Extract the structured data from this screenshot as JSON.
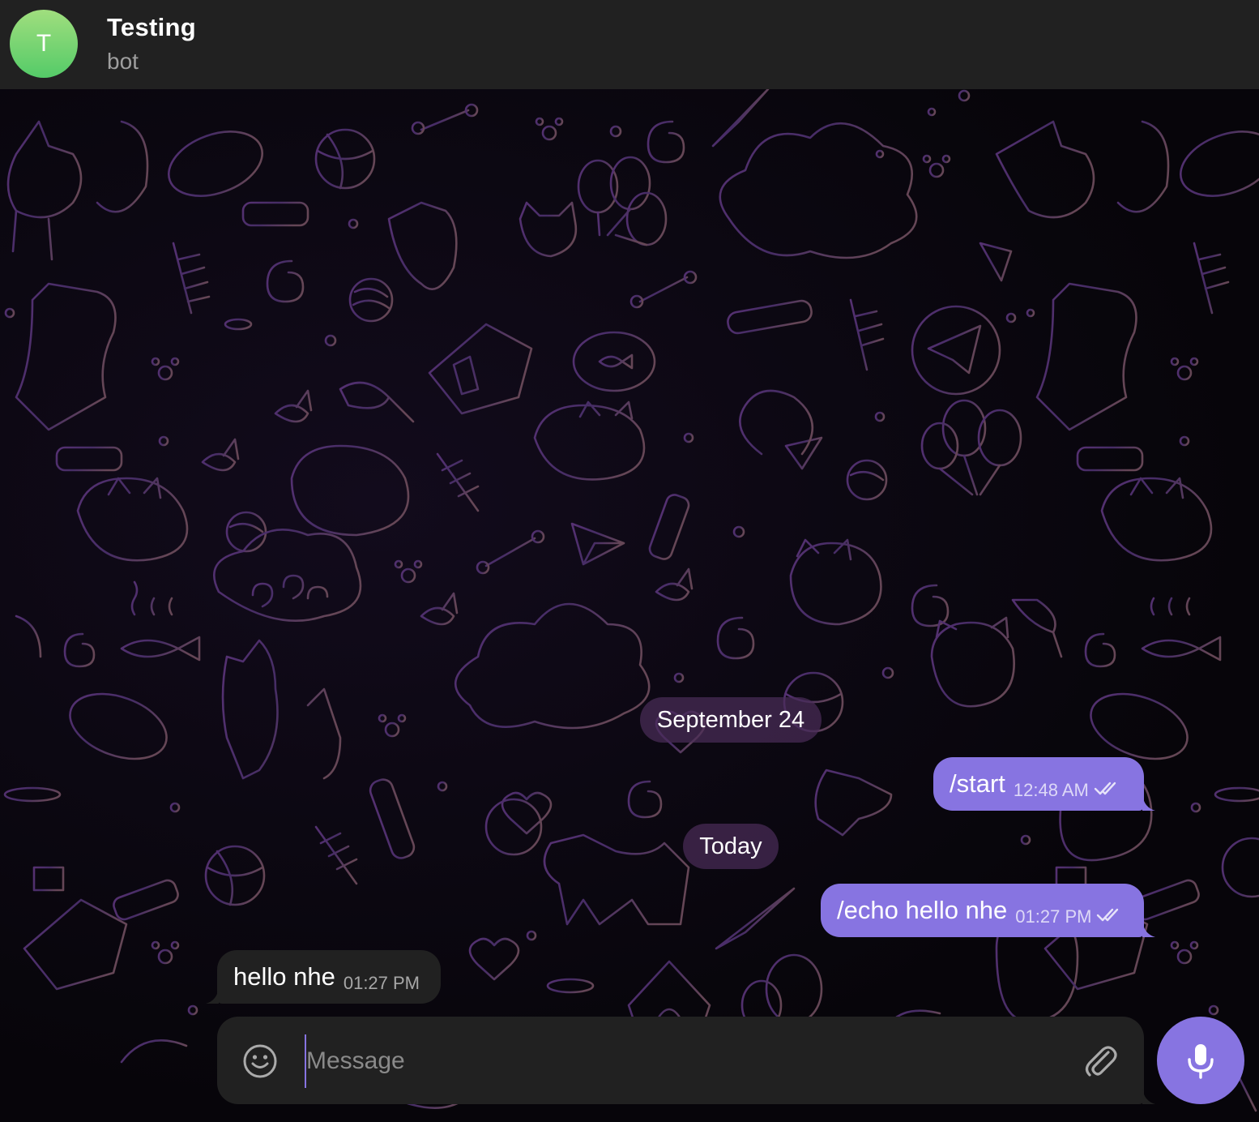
{
  "header": {
    "avatar_letter": "T",
    "title": "Testing",
    "subtitle": "bot"
  },
  "messages": {
    "date_1": "September 24",
    "date_2": "Today",
    "items": [
      {
        "direction": "outgoing",
        "text": "/start",
        "time": "12:48 AM",
        "status": "read"
      },
      {
        "direction": "outgoing",
        "text": "/echo hello nhe",
        "time": "01:27 PM",
        "status": "read"
      },
      {
        "direction": "incoming",
        "text": "hello nhe",
        "time": "01:27 PM"
      }
    ]
  },
  "composer": {
    "placeholder": "Message",
    "emoji_icon": "smile-icon",
    "attach_icon": "paperclip-icon",
    "mic_icon": "microphone-icon"
  },
  "colors": {
    "accent": "#8774e1",
    "header_bg": "#212121",
    "incoming_bubble": "#212121",
    "date_chip": "#4a2c58",
    "avatar_gradient_top": "#a0de7e",
    "avatar_gradient_bottom": "#54cb68"
  }
}
